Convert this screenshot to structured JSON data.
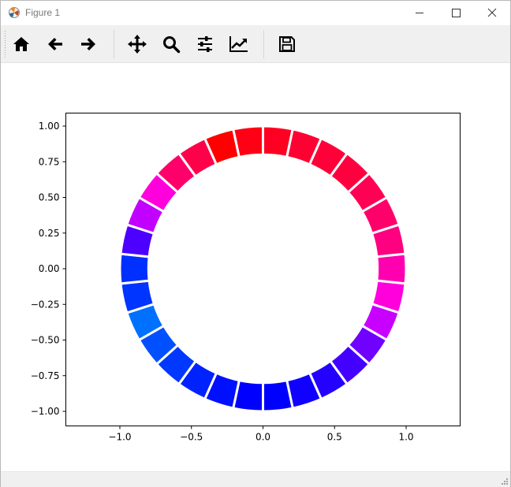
{
  "window": {
    "title": "Figure 1"
  },
  "toolbar": {
    "buttons": [
      {
        "name": "home-button",
        "icon": "home-icon"
      },
      {
        "name": "back-button",
        "icon": "arrow-left-icon"
      },
      {
        "name": "forward-button",
        "icon": "arrow-right-icon"
      },
      {
        "name": "pan-button",
        "icon": "move-icon"
      },
      {
        "name": "zoom-button",
        "icon": "magnifier-icon"
      },
      {
        "name": "configure-subplots-button",
        "icon": "sliders-icon"
      },
      {
        "name": "edit-axes-button",
        "icon": "chart-line-icon"
      },
      {
        "name": "save-button",
        "icon": "floppy-disk-icon"
      }
    ]
  },
  "chart_data": {
    "type": "pie",
    "title": "",
    "xlabel": "",
    "ylabel": "",
    "xlim": [
      -1.0,
      1.0
    ],
    "ylim": [
      -1.0,
      1.0
    ],
    "x_ticks": [
      "−1.0",
      "−0.5",
      "0.0",
      "0.5",
      "1.0"
    ],
    "y_ticks": [
      "1.00",
      "0.75",
      "0.50",
      "0.25",
      "0.00",
      "−0.25",
      "−0.50",
      "−0.75",
      "−1.00"
    ],
    "x_tick_values": [
      -1.0,
      -0.5,
      0.0,
      0.5,
      1.0
    ],
    "y_tick_values": [
      1.0,
      0.75,
      0.5,
      0.25,
      0.0,
      -0.25,
      -0.5,
      -0.75,
      -1.0
    ],
    "radius": 1.0,
    "wedge_width": 0.2,
    "start_angle_deg": 90,
    "counterclock": false,
    "edgecolor": "#ffffff",
    "segments": 30,
    "values": [
      1,
      1,
      1,
      1,
      1,
      1,
      1,
      1,
      1,
      1,
      1,
      1,
      1,
      1,
      1,
      1,
      1,
      1,
      1,
      1,
      1,
      1,
      1,
      1,
      1,
      1,
      1,
      1,
      1,
      1
    ],
    "colors": [
      "#ff0022",
      "#ff0033",
      "#ff0038",
      "#ff003f",
      "#ff0055",
      "#ff006a",
      "#ff0080",
      "#ff00b0",
      "#ff00dd",
      "#c800ff",
      "#7000ff",
      "#4400ff",
      "#2400ff",
      "#0f00ff",
      "#0000ff",
      "#0000ff",
      "#0010ff",
      "#0022ff",
      "#0038ff",
      "#0050ff",
      "#0070ff",
      "#0034ff",
      "#0030ff",
      "#4c00ff",
      "#c200ff",
      "#ff00dd",
      "#ff006a",
      "#ff004a",
      "#ff0000",
      "#ff0015"
    ]
  }
}
